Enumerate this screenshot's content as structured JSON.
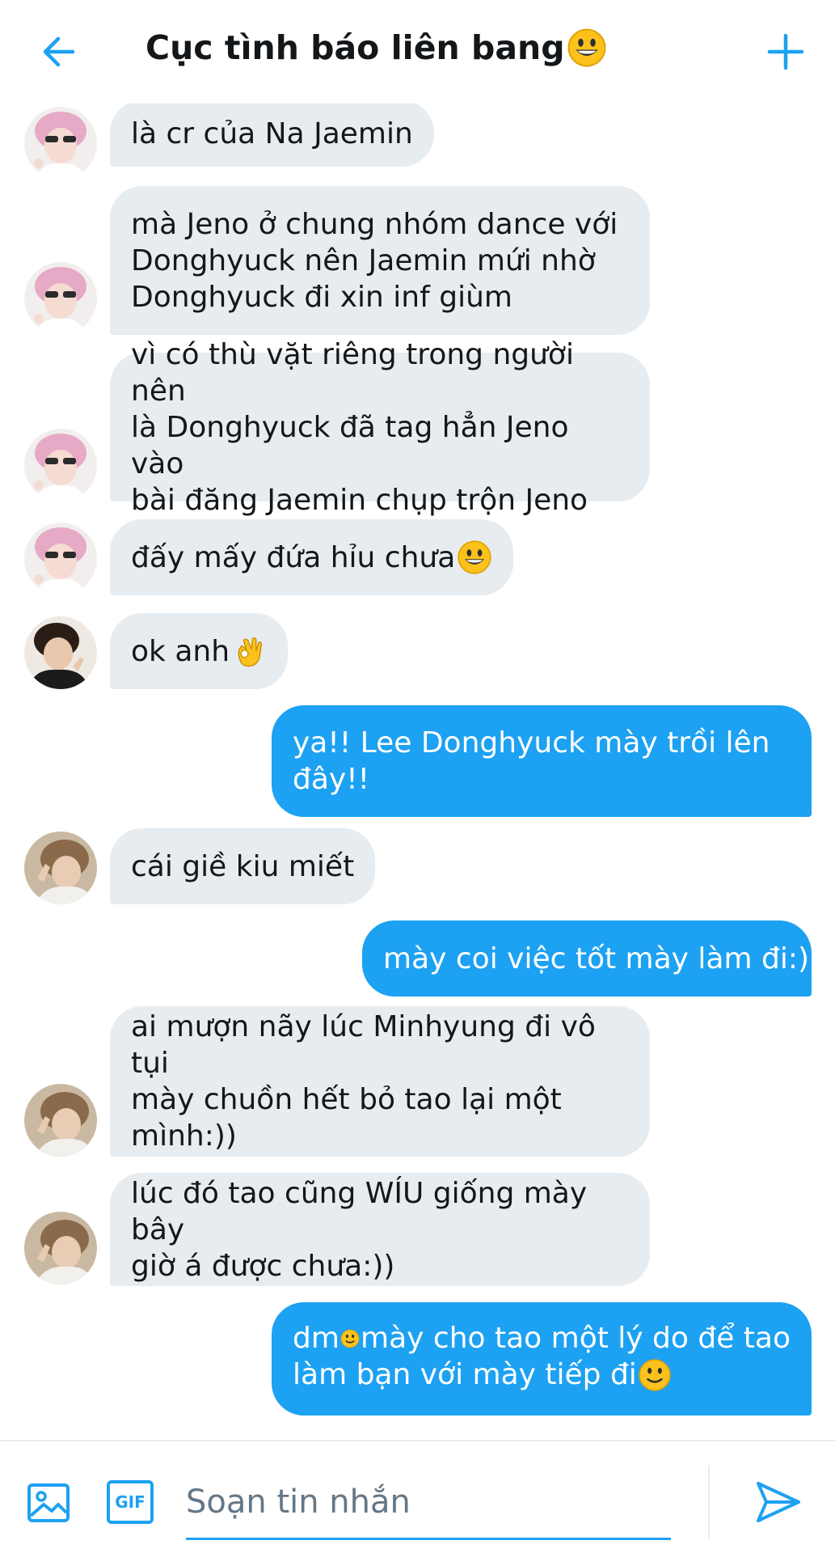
{
  "header": {
    "title": "Cục tình báo liên bang",
    "back_icon": "arrow-left-icon",
    "add_icon": "plus-icon",
    "accent": "#1da1f2"
  },
  "messages": [
    {
      "dir": "in",
      "text": "là cr của Na Jaemin",
      "avatar": "pink-hair"
    },
    {
      "dir": "in",
      "text": "mà Jeno ở chung nhóm dance với\nDonghyuck nên Jaemin mứi nhờ\nDonghyuck đi xin inf giùm",
      "avatar": "pink-hair"
    },
    {
      "dir": "in",
      "text": "vì có thù vặt riêng trong người nên\nlà Donghyuck đã tag hẳn Jeno vào\nbài đăng Jaemin chụp trộn Jeno",
      "avatar": "pink-hair"
    },
    {
      "dir": "in",
      "text": "đấy mấy đứa hỉu chưa",
      "avatar": "pink-hair",
      "emoji": "grinning"
    },
    {
      "dir": "in",
      "text": "ok anh",
      "avatar": "dark-hair",
      "emoji": "ok-hand"
    },
    {
      "dir": "out",
      "text": "ya!! Lee Donghyuck mày trồi lên\nđây!!"
    },
    {
      "dir": "in",
      "text": "cái giề kiu miết",
      "avatar": "brown-hair"
    },
    {
      "dir": "out",
      "text": "mày coi việc tốt mày làm đi:))"
    },
    {
      "dir": "in",
      "text": "ai mượn nãy lúc Minhyung đi vô tụi\nmày chuồn hết bỏ tao lại một\nmình:))",
      "avatar": "brown-hair"
    },
    {
      "dir": "in",
      "text": "lúc đó tao cũng WÍU giống mày bây\ngiờ á được chưa:))",
      "avatar": "brown-hair"
    },
    {
      "dir": "out",
      "line1_a": "dm",
      "line1_b": "mày cho tao một lý do để tao",
      "line2": "làm bạn với mày tiếp đi"
    }
  ],
  "composer": {
    "placeholder": "Soạn tin nhắn",
    "image_icon": "image-icon",
    "gif_label": "GIF",
    "send_icon": "send-icon"
  },
  "colors": {
    "incoming_bubble": "#e6ecf0",
    "outgoing_bubble": "#1da1f2",
    "text": "#14171a"
  }
}
